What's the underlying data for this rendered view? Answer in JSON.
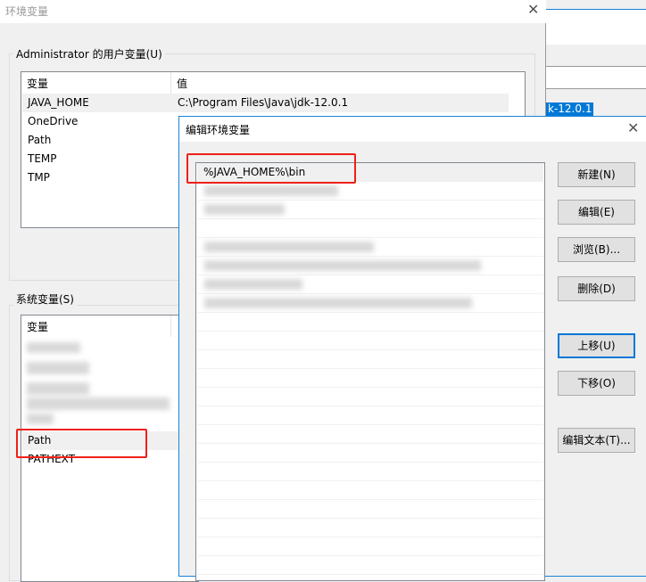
{
  "main_window": {
    "title": "环境变量",
    "user_group": "Administrator 的用户变量(U)",
    "user_columns": [
      "变量",
      "值"
    ],
    "user_rows": [
      {
        "name": "JAVA_HOME",
        "value": "C:\\Program Files\\Java\\jdk-12.0.1"
      },
      {
        "name": "OneDrive",
        "value": ""
      },
      {
        "name": "Path",
        "value": ""
      },
      {
        "name": "TEMP",
        "value": ""
      },
      {
        "name": "TMP",
        "value": ""
      }
    ],
    "system_group": "系统变量(S)",
    "system_columns": [
      "变量"
    ],
    "system_rows": [
      {
        "name": "Path"
      },
      {
        "name": "PATHEXT"
      }
    ]
  },
  "background_window": {
    "selected_text": "k-12.0.1"
  },
  "edit_dialog": {
    "title": "编辑环境变量",
    "entries": [
      "%JAVA_HOME%\\bin"
    ],
    "buttons": {
      "new": "新建(N)",
      "edit": "编辑(E)",
      "browse": "浏览(B)...",
      "delete": "删除(D)",
      "move_up": "上移(U)",
      "move_down": "下移(O)",
      "edit_text": "编辑文本(T)..."
    }
  },
  "colors": {
    "annotation": "#f0201a",
    "accent": "#0078d7"
  }
}
